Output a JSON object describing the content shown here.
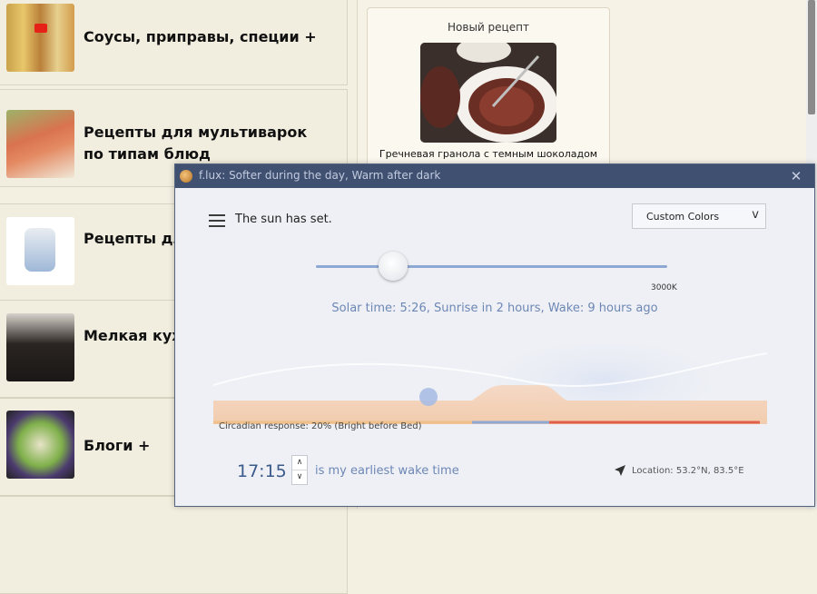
{
  "site": {
    "categories": [
      {
        "title": "Соусы, приправы, специи  +"
      },
      {
        "title": "Рецепты для мультиварок по типам блюд"
      },
      {
        "title": "Рецепты для Panasonic"
      },
      {
        "title": "Мелкая кух посуда и пр"
      },
      {
        "title": "Блоги  +"
      }
    ],
    "new_recipe": {
      "heading": "Новый рецепт",
      "caption": "Гречневая гранола с темным шоколадом"
    }
  },
  "flux": {
    "title": "f.lux: Softer during the day, Warm after dark",
    "close_label": "✕",
    "status": "The sun has set.",
    "dropdown": {
      "selected": "Custom Colors",
      "chevron": "v"
    },
    "slider": {
      "value_label": "3000K",
      "value_kelvin": 3000
    },
    "solar_text": "Solar time: 5:26, Sunrise in 2 hours, Wake: 9 hours ago",
    "curve_label": "Circadian response: 20% (Bright before Bed)",
    "wake": {
      "time": "17:15",
      "up": "∧",
      "down": "∨",
      "label": "is my earliest wake time"
    },
    "location": "Location: 53.2°N, 83.5°E",
    "icons": {
      "menu": "hamburger-icon",
      "location": "location-arrow-icon",
      "logo": "flux-logo-icon"
    },
    "colors": {
      "titlebar": "#3f5070",
      "accent": "#6d87b5",
      "warm": "#e0604a",
      "cool": "#8ea8d4"
    }
  }
}
